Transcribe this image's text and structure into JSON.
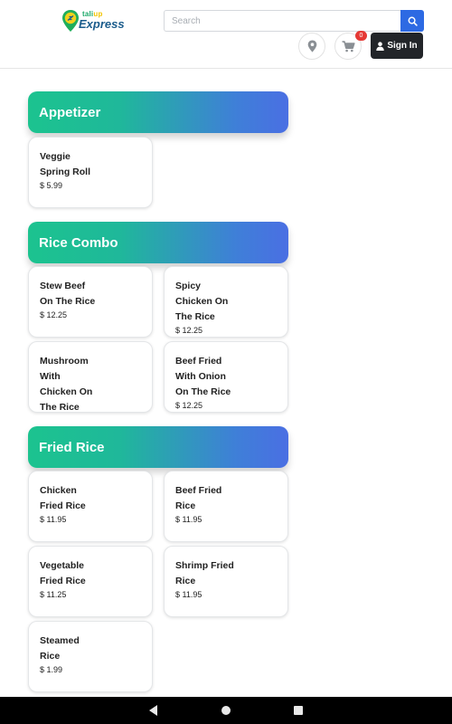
{
  "header": {
    "logo_small": "tali",
    "logo_small_accent": "up",
    "logo_main": "Express",
    "search_placeholder": "Search",
    "cart_count": "0",
    "signin_label": "Sign In",
    "icons": [
      "search-icon",
      "location-pin-icon",
      "cart-icon",
      "user-icon"
    ]
  },
  "colors": {
    "header_gradient_start": "#1cc38f",
    "header_gradient_end": "#4a6fe3",
    "search_button": "#2d6ae3",
    "signin_button": "#222529",
    "badge": "#e53935"
  },
  "sections": [
    {
      "title": "Appetizer",
      "items": [
        {
          "name": "Veggie\nSpring Roll",
          "price": "$ 5.99"
        }
      ]
    },
    {
      "title": "Rice Combo",
      "items": [
        {
          "name": "Stew Beef\nOn The Rice",
          "price": "$ 12.25"
        },
        {
          "name": "Spicy\nChicken On\nThe Rice",
          "price": "$ 12.25"
        },
        {
          "name": "Mushroom\nWith\nChicken On\nThe Rice",
          "price": ""
        },
        {
          "name": "Beef Fried\nWith Onion\nOn The Rice",
          "price": "$ 12.25"
        }
      ]
    },
    {
      "title": "Fried Rice",
      "items": [
        {
          "name": "Chicken\nFried Rice",
          "price": "$ 11.95"
        },
        {
          "name": "Beef Fried\nRice",
          "price": "$ 11.95"
        },
        {
          "name": "Vegetable\nFried Rice",
          "price": "$ 11.25"
        },
        {
          "name": "Shrimp Fried\nRice",
          "price": "$ 11.95"
        },
        {
          "name": "Steamed\nRice",
          "price": "$ 1.99"
        }
      ]
    }
  ],
  "system_nav": [
    "back-icon",
    "home-icon",
    "recents-icon"
  ]
}
